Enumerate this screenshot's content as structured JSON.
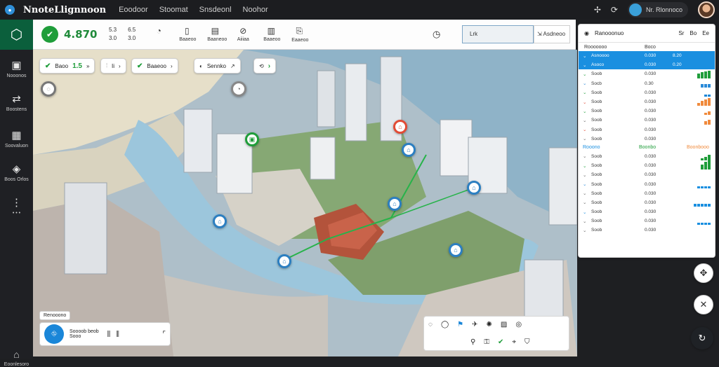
{
  "topbar": {
    "title": "NnoteLlignnoon",
    "nav": [
      "Eoodoor",
      "Stoomat",
      "Snsdeonl",
      "Noohor"
    ],
    "user_chip_label": "Nr. Rlonnoco"
  },
  "sidebar": {
    "items": [
      {
        "label": "Nooonos"
      },
      {
        "label": "Boostens"
      },
      {
        "label": "Soovaluon"
      },
      {
        "label": "Boos Orlos"
      },
      {
        "label": "• • •"
      }
    ],
    "bottom_label": "Eoonlesoro"
  },
  "toolbar": {
    "score": "4.870",
    "stats": [
      [
        "5.3",
        "3.0"
      ],
      [
        "6.5",
        "3.0"
      ]
    ],
    "tools": [
      "Baaeoo",
      "Baaneoo",
      "Aiiiaa",
      "Baaeoo",
      "Eaaeoo"
    ],
    "search_value": "Lrk",
    "search_button": "Asdneoo"
  },
  "filters": [
    {
      "label": "Baoo",
      "value": "1.5"
    },
    {
      "label": "Ii",
      "value": ""
    },
    {
      "label": "Baaeoo",
      "value": ""
    },
    {
      "label": "Sennko",
      "value": ""
    },
    {
      "label": "",
      "value": ""
    }
  ],
  "panel": {
    "title": "Ranooonuo",
    "head_right": [
      "Sr",
      "Bo",
      "Ee"
    ],
    "sub_left": "Rooooooo",
    "sub_mid": "Boco",
    "rows1": [
      {
        "name": "Asnoooo",
        "value": "0.030",
        "s": "8.20",
        "sel": true
      },
      {
        "name": "Asoco",
        "value": "0.030",
        "s": "0.20",
        "sel": true
      },
      {
        "name": "Soob",
        "value": "0.030",
        "s": ""
      },
      {
        "name": "Socb",
        "value": "0.30",
        "s": ""
      },
      {
        "name": "Soob",
        "value": "0.030",
        "s": ""
      },
      {
        "name": "Soob",
        "value": "0.030",
        "s": ""
      },
      {
        "name": "Soob",
        "value": "0.030",
        "s": ""
      },
      {
        "name": "Soob",
        "value": "0.030",
        "s": ""
      },
      {
        "name": "Soob",
        "value": "0.030",
        "s": ""
      },
      {
        "name": "Soob",
        "value": "0.030",
        "s": ""
      }
    ],
    "group2_left": "Rooono",
    "group2_mid": "Boonbo",
    "group2_right": "Boonbooo",
    "rows2": [
      {
        "name": "Soob",
        "value": "0.030"
      },
      {
        "name": "Soob",
        "value": "0.030"
      },
      {
        "name": "Soob",
        "value": "0.030"
      },
      {
        "name": "Soob",
        "value": "0.030"
      },
      {
        "name": "Soob",
        "value": "0.030"
      },
      {
        "name": "Soob",
        "value": "0.030"
      },
      {
        "name": "Soob",
        "value": "0.030"
      },
      {
        "name": "Soob",
        "value": "0.030"
      },
      {
        "name": "Soob",
        "value": "0.030"
      }
    ]
  },
  "bottom_left": {
    "label": "Renooono",
    "line1": "Soooob beob",
    "line2": "Sooo"
  },
  "colors": {
    "accent": "#1a8fe0",
    "positive": "#1f9d3a",
    "warning": "#f08a3c",
    "topbar": "#1c1d20"
  }
}
